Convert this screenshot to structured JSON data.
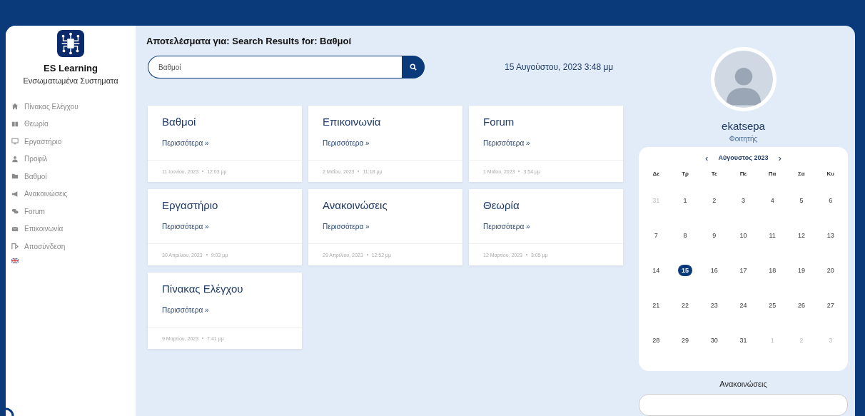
{
  "brand": {
    "title": "ES Learning",
    "subtitle": "Ενσωματωμένα Συστηματα"
  },
  "sidebar": {
    "items": [
      {
        "label": "Πίνακας Ελέγχου",
        "kind": "home"
      },
      {
        "label": "Θεωρία",
        "kind": "book"
      },
      {
        "label": "Εργαστήριο",
        "kind": "monitor"
      },
      {
        "label": "Προφίλ",
        "kind": "user"
      },
      {
        "label": "Βαθμοί",
        "kind": "folder"
      },
      {
        "label": "Ανακοινώσεις",
        "kind": "megaphone"
      },
      {
        "label": "Forum",
        "kind": "chat"
      },
      {
        "label": "Επικοινωνία",
        "kind": "mail"
      },
      {
        "label": "Αποσύνδεση",
        "kind": "logout"
      }
    ]
  },
  "heading": "Αποτελέσματα για: Search Results for: Βαθμοί",
  "search": {
    "value": "Βαθμοί"
  },
  "datetime": "15 Αυγούστου, 2023 3:48 μμ",
  "results": [
    {
      "title": "Βαθμοί",
      "link": "Περισσότερα »",
      "date": "11 Ιουνίου, 2023",
      "time": "12:03 μμ"
    },
    {
      "title": "Επικοινωνία",
      "link": "Περισσότερα »",
      "date": "2 Μαΐου, 2023",
      "time": "11:18 μμ"
    },
    {
      "title": "Forum",
      "link": "Περισσότερα »",
      "date": "1 Μαΐου, 2023",
      "time": "3:54 μμ"
    },
    {
      "title": "Εργαστήριο",
      "link": "Περισσότερα »",
      "date": "30 Απριλίου, 2023",
      "time": "9:03 μμ"
    },
    {
      "title": "Ανακοινώσεις",
      "link": "Περισσότερα »",
      "date": "29 Απριλίου, 2023",
      "time": "12:52 μμ"
    },
    {
      "title": "Θεωρία",
      "link": "Περισσότερα »",
      "date": "12 Μαρτίου, 2023",
      "time": "3:05 μμ"
    },
    {
      "title": "Πίνακας Ελέγχου",
      "link": "Περισσότερα »",
      "date": "9 Μαρτίου, 2023",
      "time": "7:41 μμ"
    }
  ],
  "profile": {
    "username": "ekatsepa",
    "role": "Φοιτητής"
  },
  "calendar": {
    "prev": "‹",
    "month": "Αύγουστος 2023",
    "next": "›",
    "weekdays": [
      "Δε",
      "Τρ",
      "Τε",
      "Πε",
      "Πα",
      "Σα",
      "Κυ"
    ],
    "weeks": [
      [
        {
          "label": "31",
          "muted": true,
          "selected": false
        },
        {
          "label": "1",
          "muted": false,
          "selected": false
        },
        {
          "label": "2",
          "muted": false,
          "selected": false
        },
        {
          "label": "3",
          "muted": false,
          "selected": false
        },
        {
          "label": "4",
          "muted": false,
          "selected": false
        },
        {
          "label": "5",
          "muted": false,
          "selected": false
        },
        {
          "label": "6",
          "muted": false,
          "selected": false
        }
      ],
      [
        {
          "label": "7",
          "muted": false,
          "selected": false
        },
        {
          "label": "8",
          "muted": false,
          "selected": false
        },
        {
          "label": "9",
          "muted": false,
          "selected": false
        },
        {
          "label": "10",
          "muted": false,
          "selected": false
        },
        {
          "label": "11",
          "muted": false,
          "selected": false
        },
        {
          "label": "12",
          "muted": false,
          "selected": false
        },
        {
          "label": "13",
          "muted": false,
          "selected": false
        }
      ],
      [
        {
          "label": "14",
          "muted": false,
          "selected": false
        },
        {
          "label": "15",
          "muted": false,
          "selected": true
        },
        {
          "label": "16",
          "muted": false,
          "selected": false
        },
        {
          "label": "17",
          "muted": false,
          "selected": false
        },
        {
          "label": "18",
          "muted": false,
          "selected": false
        },
        {
          "label": "19",
          "muted": false,
          "selected": false
        },
        {
          "label": "20",
          "muted": false,
          "selected": false
        }
      ],
      [
        {
          "label": "21",
          "muted": false,
          "selected": false
        },
        {
          "label": "22",
          "muted": false,
          "selected": false
        },
        {
          "label": "23",
          "muted": false,
          "selected": false
        },
        {
          "label": "24",
          "muted": false,
          "selected": false
        },
        {
          "label": "25",
          "muted": false,
          "selected": false
        },
        {
          "label": "26",
          "muted": false,
          "selected": false
        },
        {
          "label": "27",
          "muted": false,
          "selected": false
        }
      ],
      [
        {
          "label": "28",
          "muted": false,
          "selected": false
        },
        {
          "label": "29",
          "muted": false,
          "selected": false
        },
        {
          "label": "30",
          "muted": false,
          "selected": false
        },
        {
          "label": "31",
          "muted": false,
          "selected": false
        },
        {
          "label": "1",
          "muted": true,
          "selected": false
        },
        {
          "label": "2",
          "muted": true,
          "selected": false
        },
        {
          "label": "3",
          "muted": true,
          "selected": false
        }
      ]
    ]
  },
  "announcements": {
    "title": "Ανακοινώσεις"
  }
}
